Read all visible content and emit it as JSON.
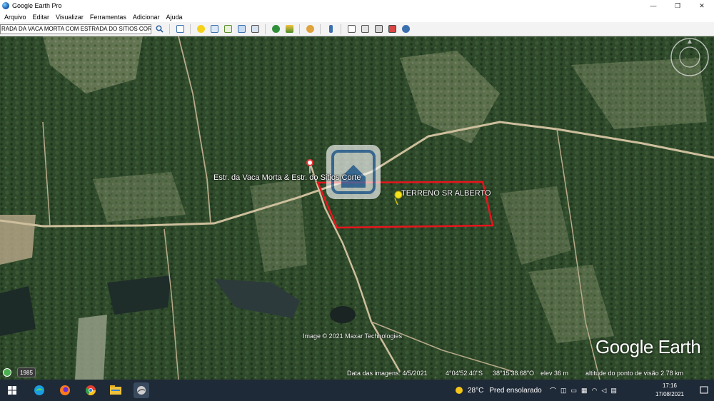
{
  "window": {
    "title": "Google Earth Pro",
    "minimize_glyph": "—",
    "maximize_glyph": "❐",
    "close_glyph": "✕"
  },
  "menu": {
    "items": [
      "Arquivo",
      "Editar",
      "Visualizar",
      "Ferramentas",
      "Adicionar",
      "Ajuda"
    ]
  },
  "toolbar": {
    "search_value": "RADA DA VACA MORTA COM ESTRADA DO SITIOS CORTE",
    "icons": [
      "search-icon",
      "sidebar-toggle-icon",
      "placemark-icon",
      "polygon-icon",
      "path-icon",
      "image-overlay-icon",
      "record-tour-icon",
      "historical-imagery-icon",
      "sunlight-icon",
      "planets-icon",
      "ruler-icon",
      "email-icon",
      "print-icon",
      "save-image-icon",
      "google-maps-icon",
      "kml-icon"
    ]
  },
  "map": {
    "road_label": "Estr. da Vaca Morta & Estr. do Sitios Corte",
    "placemark_label": "TERRENO SR ALBERTO",
    "polygon_color": "#e8141c",
    "logo_text": "Google Earth",
    "imagery_credit": "Image © 2021 Maxar Technologies"
  },
  "status": {
    "historical_year": "1985",
    "imagery_date": "Data das imagens: 4/5/2021",
    "latitude": "4°04'52.40\"S",
    "longitude": "38°15'38.68\"O",
    "elevation": "elev   36 m",
    "eye_altitude": "altitude do ponto de visão   2.78 km"
  },
  "taskbar": {
    "apps": [
      "windows-start-icon",
      "edge-icon",
      "firefox-icon",
      "chrome-icon",
      "file-explorer-icon",
      "google-earth-icon"
    ],
    "weather_temp": "28°C",
    "weather_text": "Pred ensolarado",
    "time": "17:16",
    "date": "17/08/2021"
  }
}
